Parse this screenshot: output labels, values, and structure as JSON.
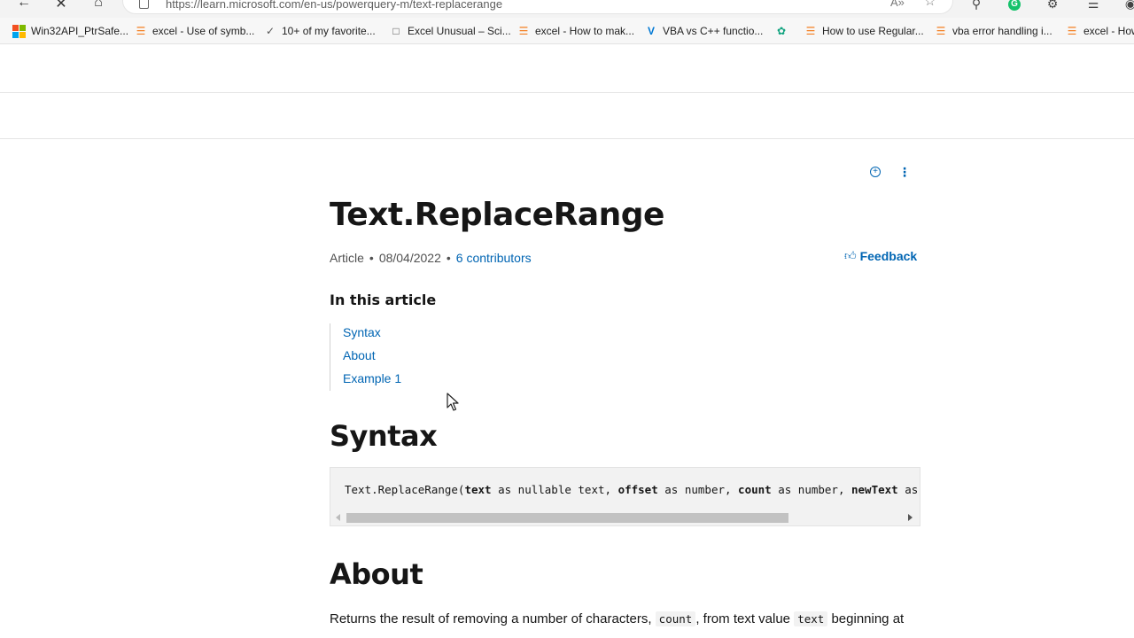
{
  "browser": {
    "url": "https://learn.microsoft.com/en-us/powerquery-m/text-replacerange",
    "read_aloud": "A»",
    "bookmarks": [
      {
        "label": "Win32API_PtrSafe...",
        "icon": "microsoft-icon"
      },
      {
        "label": "excel - Use of symb...",
        "icon": "stackoverflow-icon"
      },
      {
        "label": "10+ of my favorite...",
        "icon": "link-icon"
      },
      {
        "label": "Excel Unusual – Sci...",
        "icon": "document-icon"
      },
      {
        "label": "excel - How to mak...",
        "icon": "stackoverflow-icon"
      },
      {
        "label": "VBA vs C++ functio...",
        "icon": "v-icon"
      },
      {
        "label": "",
        "icon": "chatgpt-icon"
      },
      {
        "label": "How to use Regular...",
        "icon": "stackoverflow-icon"
      },
      {
        "label": "vba error handling i...",
        "icon": "stackoverflow-icon"
      },
      {
        "label": "excel - How",
        "icon": "stackoverflow-icon"
      }
    ]
  },
  "article": {
    "title": "Text.ReplaceRange",
    "meta": {
      "type": "Article",
      "date": "08/04/2022",
      "contributors": "6 contributors"
    },
    "feedback_label": "Feedback",
    "toc_heading": "In this article",
    "toc": [
      "Syntax",
      "About",
      "Example 1"
    ],
    "syntax_heading": "Syntax",
    "syntax_code": {
      "fn": "Text.ReplaceRange(",
      "p1": "text",
      "t1": " as nullable text, ",
      "p2": "offset",
      "t2": " as number, ",
      "p3": "count",
      "t3": " as number, ",
      "p4": "newText",
      "t4": " as t"
    },
    "about_heading": "About",
    "about_text": {
      "a": "Returns the result of removing a number of characters, ",
      "c1": "count",
      "b": ", from text value ",
      "c2": "text",
      "c": " beginning at"
    }
  }
}
